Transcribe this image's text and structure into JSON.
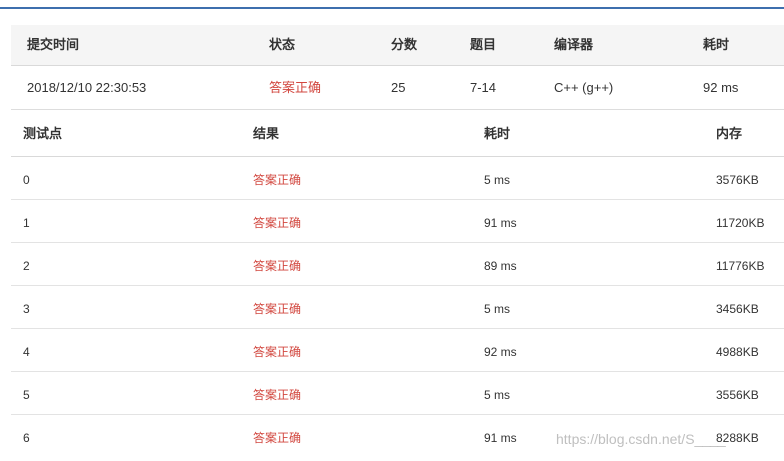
{
  "submission": {
    "headers": {
      "time": "提交时间",
      "status": "状态",
      "score": "分数",
      "problem": "题目",
      "compiler": "编译器",
      "cost": "耗时"
    },
    "row": {
      "time": "2018/12/10 22:30:53",
      "status": "答案正确",
      "score": "25",
      "problem": "7-14",
      "compiler": "C++ (g++)",
      "cost": "92 ms"
    }
  },
  "cases": {
    "headers": {
      "id": "测试点",
      "result": "结果",
      "time": "耗时",
      "memory": "内存"
    },
    "rows": [
      {
        "id": "0",
        "result": "答案正确",
        "time": "5 ms",
        "memory": "3576KB"
      },
      {
        "id": "1",
        "result": "答案正确",
        "time": "91 ms",
        "memory": "11720KB"
      },
      {
        "id": "2",
        "result": "答案正确",
        "time": "89 ms",
        "memory": "11776KB"
      },
      {
        "id": "3",
        "result": "答案正确",
        "time": "5 ms",
        "memory": "3456KB"
      },
      {
        "id": "4",
        "result": "答案正确",
        "time": "92 ms",
        "memory": "4988KB"
      },
      {
        "id": "5",
        "result": "答案正确",
        "time": "5 ms",
        "memory": "3556KB"
      },
      {
        "id": "6",
        "result": "答案正确",
        "time": "91 ms",
        "memory": "8288KB"
      }
    ]
  },
  "watermark": "https://blog.csdn.net/S____",
  "colors": {
    "accent_line": "#3e6fae",
    "correct": "#d2473f",
    "header_bg": "#f5f5f5"
  }
}
